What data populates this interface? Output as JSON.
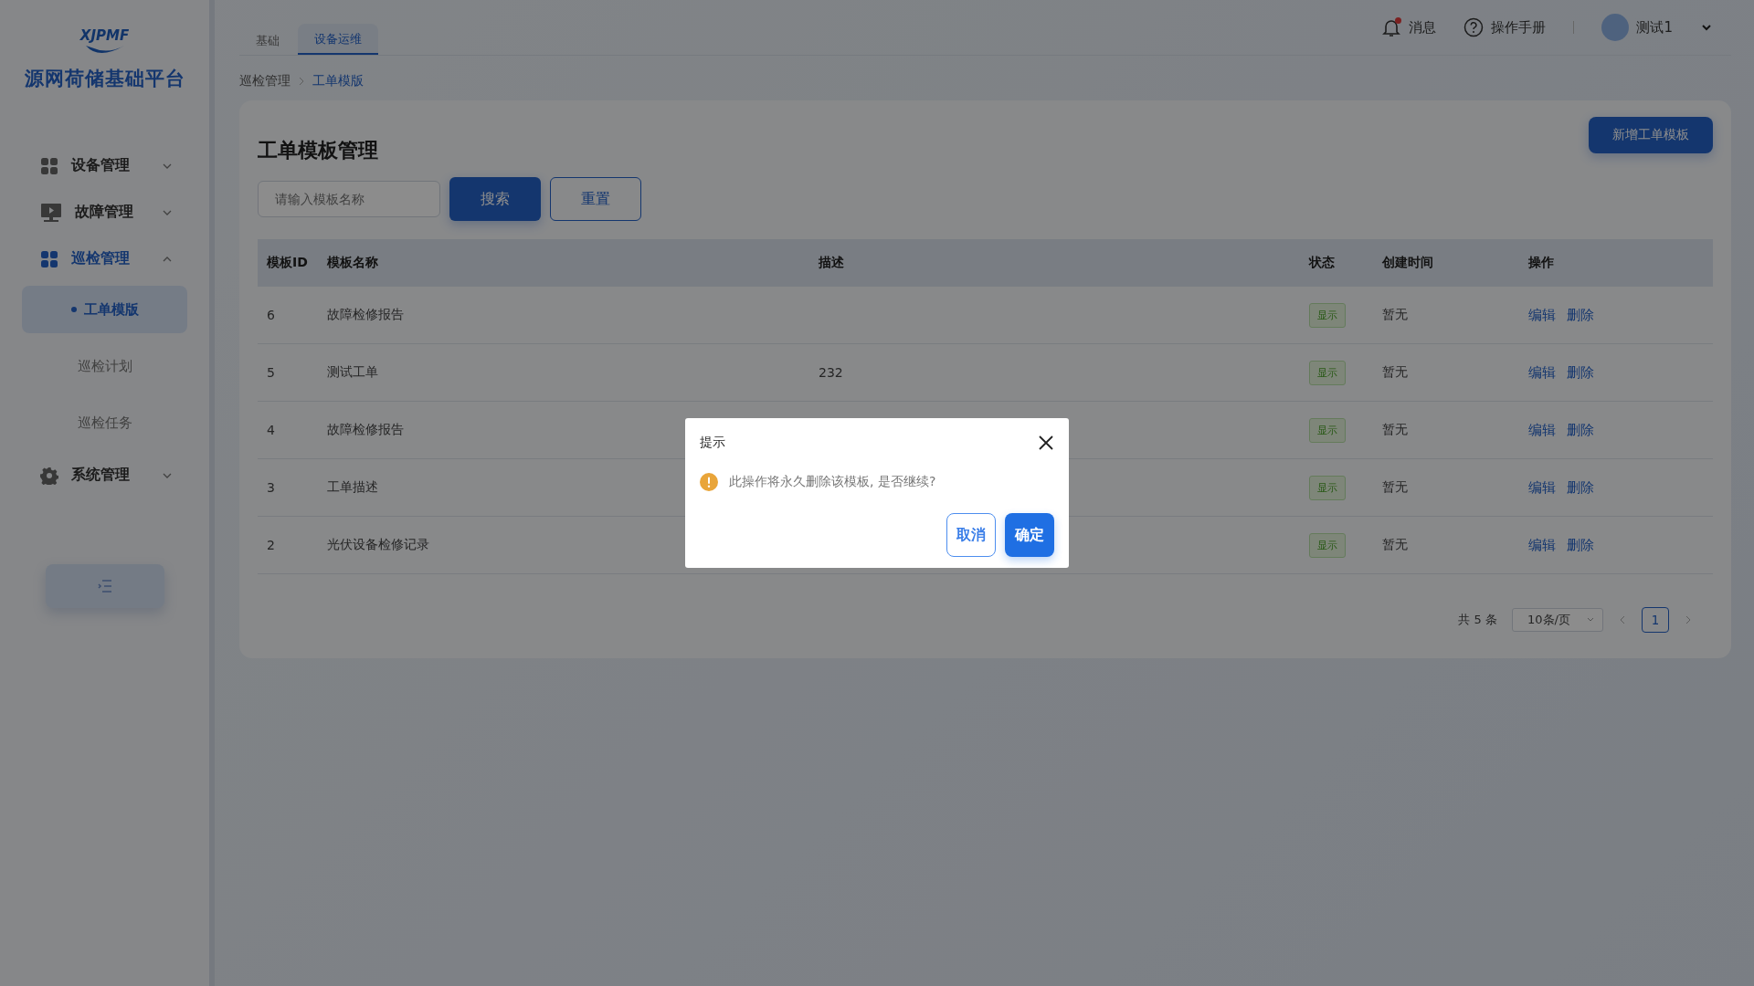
{
  "sidebar": {
    "logo_text": "XJPMF",
    "app_title": "源网荷储基础平台",
    "menu": [
      {
        "label": "设备管理",
        "kind": "grid",
        "expanded": false,
        "selected": false
      },
      {
        "label": "故障管理",
        "kind": "monitor",
        "expanded": false,
        "selected": false
      },
      {
        "label": "巡检管理",
        "kind": "grid",
        "expanded": true,
        "selected": true,
        "children": [
          {
            "label": "工单模版",
            "selected": true
          },
          {
            "label": "巡检计划",
            "selected": false
          },
          {
            "label": "巡检任务",
            "selected": false
          }
        ]
      },
      {
        "label": "系统管理",
        "kind": "gear",
        "expanded": false,
        "selected": false
      }
    ]
  },
  "top_tabs": [
    {
      "label": "基础",
      "selected": false
    },
    {
      "label": "设备运维",
      "selected": true
    }
  ],
  "header": {
    "messages": {
      "label": "消息",
      "unread": true
    },
    "manual": "操作手册",
    "user": "测试1"
  },
  "breadcrumb": [
    {
      "label": "巡检管理",
      "current": false
    },
    {
      "label": "工单模版",
      "current": true
    }
  ],
  "page": {
    "title": "工单模板管理",
    "add_button": "新增工单模板",
    "search": {
      "placeholder": "请输入模板名称"
    },
    "search_button": "搜索",
    "reset_button": "重置"
  },
  "table": {
    "columns": [
      "模板ID",
      "模板名称",
      "描述",
      "状态",
      "创建时间",
      "操作"
    ],
    "rows": [
      {
        "id": "6",
        "name": "故障检修报告",
        "status": "显示",
        "created": "暂无",
        "actions": [
          "编辑",
          "删除"
        ]
      },
      {
        "id": "5",
        "name": "测试工单",
        "description": "232",
        "status": "显示",
        "created": "暂无",
        "actions": [
          "编辑",
          "删除"
        ]
      },
      {
        "id": "4",
        "name": "故障检修报告",
        "status": "显示",
        "created": "暂无",
        "actions": [
          "编辑",
          "删除"
        ]
      },
      {
        "id": "3",
        "name": "工单描述",
        "status": "显示",
        "created": "暂无",
        "actions": [
          "编辑",
          "删除"
        ]
      },
      {
        "id": "2",
        "name": "光伏设备检修记录",
        "status": "显示",
        "created": "暂无",
        "actions": [
          "编辑",
          "删除"
        ]
      }
    ]
  },
  "pagination": {
    "total": "共 5 条",
    "page_size": "10条/页",
    "pages": [
      {
        "label": "1",
        "selected": true
      }
    ]
  },
  "dialog": {
    "title": "提示",
    "message": "此操作将永久删除该模板, 是否继续?",
    "cancel": "取消",
    "confirm": "确定"
  }
}
